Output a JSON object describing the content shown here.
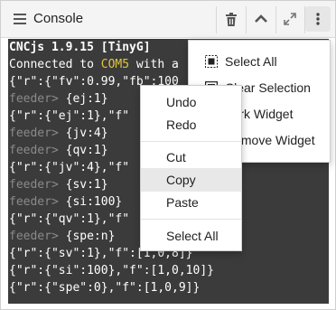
{
  "widget": {
    "title": "Console",
    "toolbar_icons": [
      "trash-icon",
      "chevron-up-icon",
      "expand-icon",
      "more-vertical-icon"
    ]
  },
  "console": {
    "lines": [
      {
        "parts": [
          {
            "t": "CNCjs 1.9.15 [TinyG]",
            "c": ""
          }
        ],
        "bold": true
      },
      {
        "parts": [
          {
            "t": "Connected to ",
            "c": ""
          },
          {
            "t": "COM5",
            "c": "port"
          },
          {
            "t": " with a",
            "c": ""
          }
        ]
      },
      {
        "parts": [
          {
            "t": "{\"r\":{\"fv\":0.99,\"fb\":100",
            "c": ""
          }
        ]
      },
      {
        "parts": [
          {
            "t": "feeder>",
            "c": "prompt"
          },
          {
            "t": " {ej:1}",
            "c": ""
          }
        ]
      },
      {
        "parts": [
          {
            "t": "{\"r\":{\"ej\":1},\"f\"",
            "c": ""
          }
        ]
      },
      {
        "parts": [
          {
            "t": "feeder>",
            "c": "prompt"
          },
          {
            "t": " {jv:4}",
            "c": ""
          }
        ]
      },
      {
        "parts": [
          {
            "t": "feeder>",
            "c": "prompt"
          },
          {
            "t": " {qv:1}",
            "c": ""
          }
        ]
      },
      {
        "parts": [
          {
            "t": "{\"r\":{\"jv\":4},\"f\"",
            "c": ""
          }
        ]
      },
      {
        "parts": [
          {
            "t": "feeder>",
            "c": "prompt"
          },
          {
            "t": " {sv:1}",
            "c": ""
          }
        ]
      },
      {
        "parts": [
          {
            "t": "feeder>",
            "c": "prompt"
          },
          {
            "t": " {si:100}",
            "c": ""
          }
        ]
      },
      {
        "parts": [
          {
            "t": "{\"r\":{\"qv\":1},\"f\"",
            "c": ""
          }
        ]
      },
      {
        "parts": [
          {
            "t": "feeder>",
            "c": "prompt"
          },
          {
            "t": " {spe:n}",
            "c": ""
          }
        ]
      },
      {
        "parts": [
          {
            "t": "{\"r\":{\"sv\":1},\"f\":[1,0,8]}",
            "c": ""
          }
        ]
      },
      {
        "parts": [
          {
            "t": "{\"r\":{\"si\":100},\"f\":[1,0,10]}",
            "c": ""
          }
        ]
      },
      {
        "parts": [
          {
            "t": "{\"r\":{\"spe\":0},\"f\":[1,0,9]}",
            "c": ""
          }
        ]
      }
    ]
  },
  "widget_menu": {
    "items": [
      {
        "label": "Select All",
        "icon": "select-all-icon"
      },
      {
        "label": "Clear Selection",
        "icon": "clear-selection-icon"
      },
      {
        "label": "Fork Widget",
        "icon": "fork-icon"
      },
      {
        "label": "Remove Widget",
        "icon": "remove-icon"
      }
    ]
  },
  "context_menu": {
    "groups": [
      [
        "Undo",
        "Redo"
      ],
      [
        "Cut",
        "Copy",
        "Paste"
      ],
      [
        "Select All"
      ]
    ],
    "highlighted": "Copy"
  }
}
